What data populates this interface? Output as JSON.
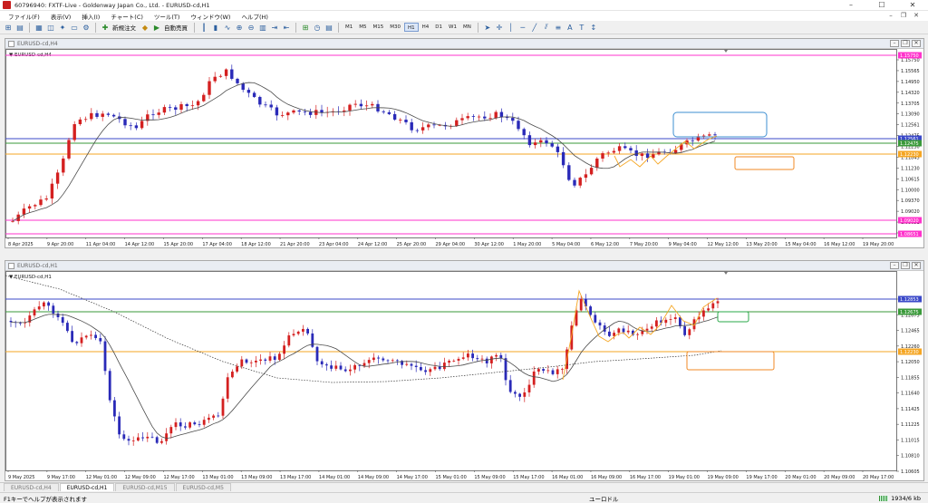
{
  "window": {
    "title": "60796940: FXTF-Live - Goldenway Japan Co., Ltd. - EURUSD-cd,H1",
    "controls": [
      "–",
      "☐",
      "✕"
    ]
  },
  "menu": [
    "ファイル(F)",
    "表示(V)",
    "挿入(I)",
    "チャート(C)",
    "ツール(T)",
    "ウィンドウ(W)",
    "ヘルプ(H)"
  ],
  "toolbar": {
    "new_order": "新規注文",
    "auto_trade": "自動売買",
    "timeframes": [
      "M1",
      "M5",
      "M15",
      "M30",
      "H1",
      "H4",
      "D1",
      "W1",
      "MN"
    ],
    "active_timeframe": "H1"
  },
  "chart_h4": {
    "window_title": "EURUSD-cd,H4",
    "label": "EURUSD-cd,H4",
    "price_labels": [
      "1.15750",
      "1.15565",
      "1.14950",
      "1.14320",
      "1.13705",
      "1.13090",
      "1.12561",
      "1.12475",
      "1.12230",
      "1.11845",
      "1.11230",
      "1.10615",
      "1.10000",
      "1.09370",
      "1.09020",
      "1.08651",
      "1.08755"
    ],
    "highlight_labels": {
      "magenta_top": "1.15750",
      "blue": "1.12561",
      "green": "1.12475",
      "orange": "1.12230",
      "magenta_low1": "1.09020",
      "magenta_low2": "1.08651"
    },
    "time_labels": [
      "8 Apr 2025",
      "9 Apr 20:00",
      "11 Apr 04:00",
      "14 Apr 12:00",
      "15 Apr 20:00",
      "17 Apr 04:00",
      "18 Apr 12:00",
      "21 Apr 20:00",
      "23 Apr 04:00",
      "24 Apr 12:00",
      "25 Apr 20:00",
      "29 Apr 04:00",
      "30 Apr 12:00",
      "1 May 20:00",
      "5 May 04:00",
      "6 May 12:00",
      "7 May 20:00",
      "9 May 04:00",
      "12 May 12:00",
      "13 May 20:00",
      "15 May 04:00",
      "16 May 12:00",
      "19 May 20:00"
    ]
  },
  "chart_h1": {
    "window_title": "EURUSD-cd,H1",
    "label": "EURUSD-cd,H1",
    "price_labels": [
      "1.12853",
      "1.12675",
      "1.12465",
      "1.12260",
      "1.12050",
      "1.11855",
      "1.11640",
      "1.11425",
      "1.11225",
      "1.11015",
      "1.10810",
      "1.10605"
    ],
    "highlight_labels": {
      "blue": "1.12853",
      "green": "1.12675",
      "orange": "1.12230"
    },
    "time_labels": [
      "9 May 2025",
      "9 May 17:00",
      "12 May 01:00",
      "12 May 09:00",
      "12 May 17:00",
      "13 May 01:00",
      "13 May 09:00",
      "13 May 17:00",
      "14 May 01:00",
      "14 May 09:00",
      "14 May 17:00",
      "15 May 01:00",
      "15 May 09:00",
      "15 May 17:00",
      "16 May 01:00",
      "16 May 09:00",
      "16 May 17:00",
      "19 May 01:00",
      "19 May 09:00",
      "19 May 17:00",
      "20 May 01:00",
      "20 May 09:00",
      "20 May 17:00"
    ]
  },
  "tabs": [
    "EURUSD-cd,H4",
    "EURUSD-cd,H1",
    "EURUSD-cd,M15",
    "EURUSD-cd,M5"
  ],
  "active_tab": "EURUSD-cd,H1",
  "status": {
    "hint": "F1キーでヘルプが表示されます",
    "profile": "ユーロドル",
    "traffic": "1934/6 kb"
  },
  "colors": {
    "bull": "#d42020",
    "bear": "#2a2ab8",
    "ma": "#4a4a4a",
    "magenta": "#ff33cc",
    "blue_line": "#3b49c9",
    "green_line": "#3a9a3a",
    "orange_line": "#f5a623",
    "box_blue": "#3d8fd1",
    "box_orange": "#f08a24",
    "box_green": "#2aa84a"
  }
}
